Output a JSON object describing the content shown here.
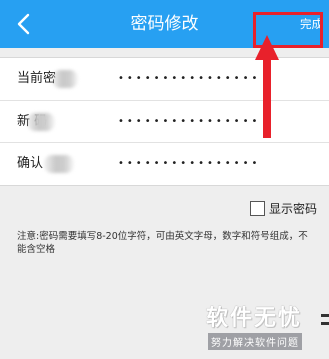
{
  "header": {
    "title": "密码修改",
    "done_label": "完成",
    "background": "#27a0f2"
  },
  "form": {
    "rows": [
      {
        "label": "当前密",
        "value": "••••••••••••••••"
      },
      {
        "label": "新  码",
        "value": "••••••••••••••••"
      },
      {
        "label": "确认",
        "value": "••••••••••••••••"
      }
    ]
  },
  "show_password": {
    "label": "显示密码",
    "checked": false
  },
  "note": "注意:密码需要填写8-20位字符，可由英文字母，数字和符号组成，不能含空格",
  "watermark": {
    "main": "软件无忧",
    "sub": "努力解决软件问题"
  },
  "annotation_color": "#e8212b"
}
